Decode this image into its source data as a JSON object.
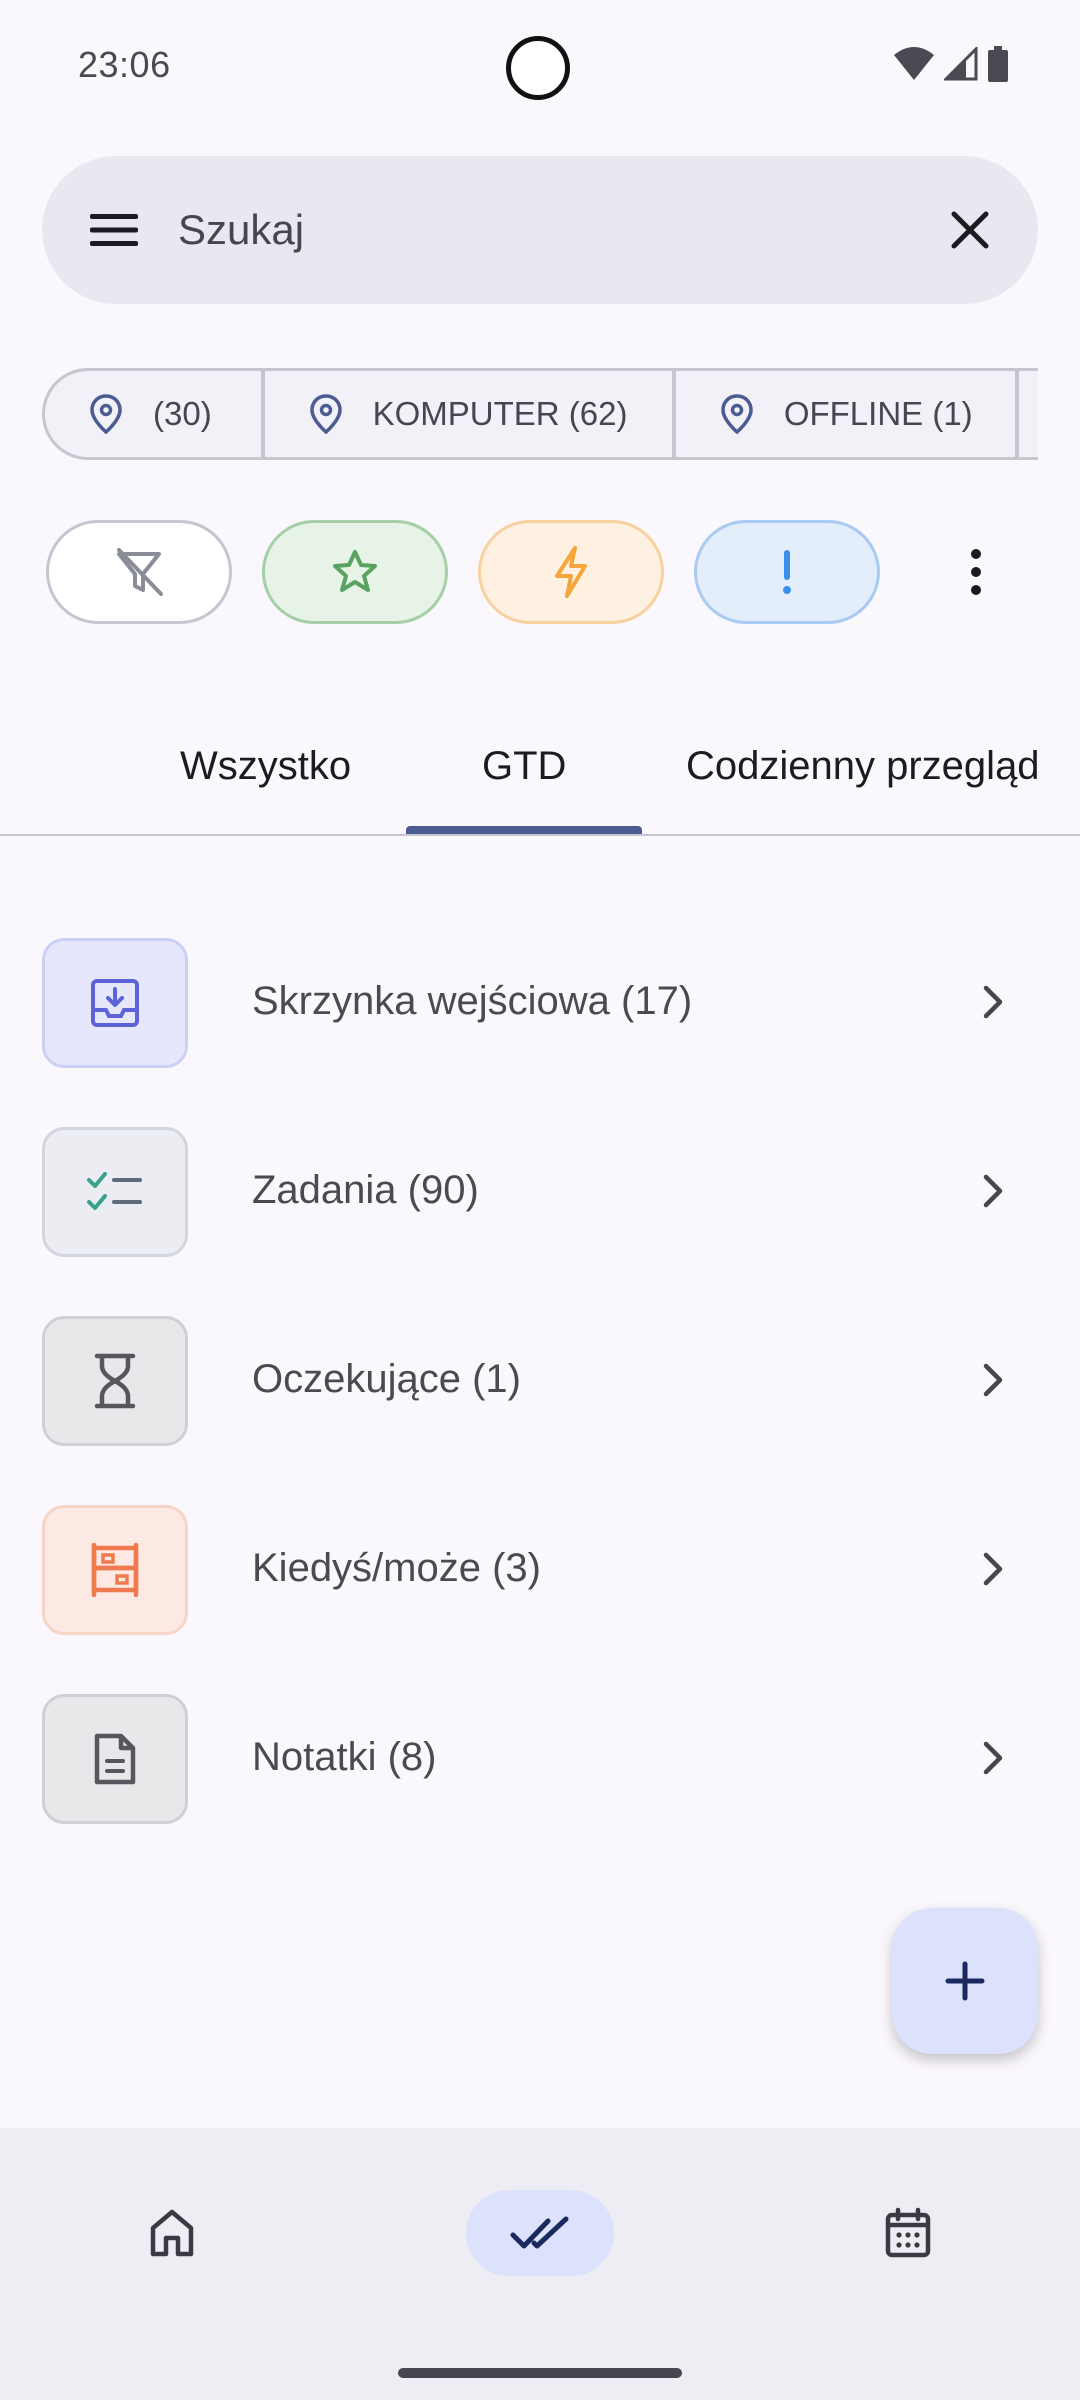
{
  "status_bar": {
    "time": "23:06"
  },
  "search": {
    "placeholder": "Szukaj"
  },
  "contexts": [
    {
      "label": "(30)"
    },
    {
      "label": "KOMPUTER (62)"
    },
    {
      "label": "OFFLINE (1)"
    }
  ],
  "filters": [
    {
      "icon": "filter-off-icon",
      "color": "#8a8c98",
      "border": "#c6c6d0",
      "bg": "#ffffff"
    },
    {
      "icon": "star-icon",
      "color": "#5aa25f",
      "border": "#a5d0a7",
      "bg": "#e6f3e6"
    },
    {
      "icon": "lightning-icon",
      "color": "#f5a53a",
      "border": "#f9d0a0",
      "bg": "#fff1e2"
    },
    {
      "icon": "priority-icon",
      "color": "#3b8fe8",
      "border": "#a7cbf3",
      "bg": "#e4eefb"
    }
  ],
  "tabs": [
    {
      "label": "Wszystko"
    },
    {
      "label": "GTD"
    },
    {
      "label": "Codzienny przegląd"
    }
  ],
  "active_tab": "GTD",
  "lists": [
    {
      "label": "Skrzynka wejściowa (17)",
      "icon": "inbox-icon",
      "color": "#5b63d6",
      "border": "#cdd0f5",
      "bg": "#e6e7fd"
    },
    {
      "label": "Zadania (90)",
      "icon": "checklist-icon",
      "color": "#5d6b7a",
      "border": "#d3d6de",
      "bg": "#ebedf3"
    },
    {
      "label": "Oczekujące (1)",
      "icon": "hourglass-icon",
      "color": "#55565e",
      "border": "#d0d0d4",
      "bg": "#e8e8eb"
    },
    {
      "label": "Kiedyś/może (3)",
      "icon": "shelf-icon",
      "color": "#f07a50",
      "border": "#f8d4c7",
      "bg": "#fde9e3"
    },
    {
      "label": "Notatki (8)",
      "icon": "note-icon",
      "color": "#55565e",
      "border": "#d0d0d4",
      "bg": "#e8e8eb"
    }
  ],
  "bottom_nav": [
    {
      "icon": "home-icon"
    },
    {
      "icon": "tasks-done-icon",
      "active": true
    },
    {
      "icon": "calendar-icon"
    }
  ]
}
